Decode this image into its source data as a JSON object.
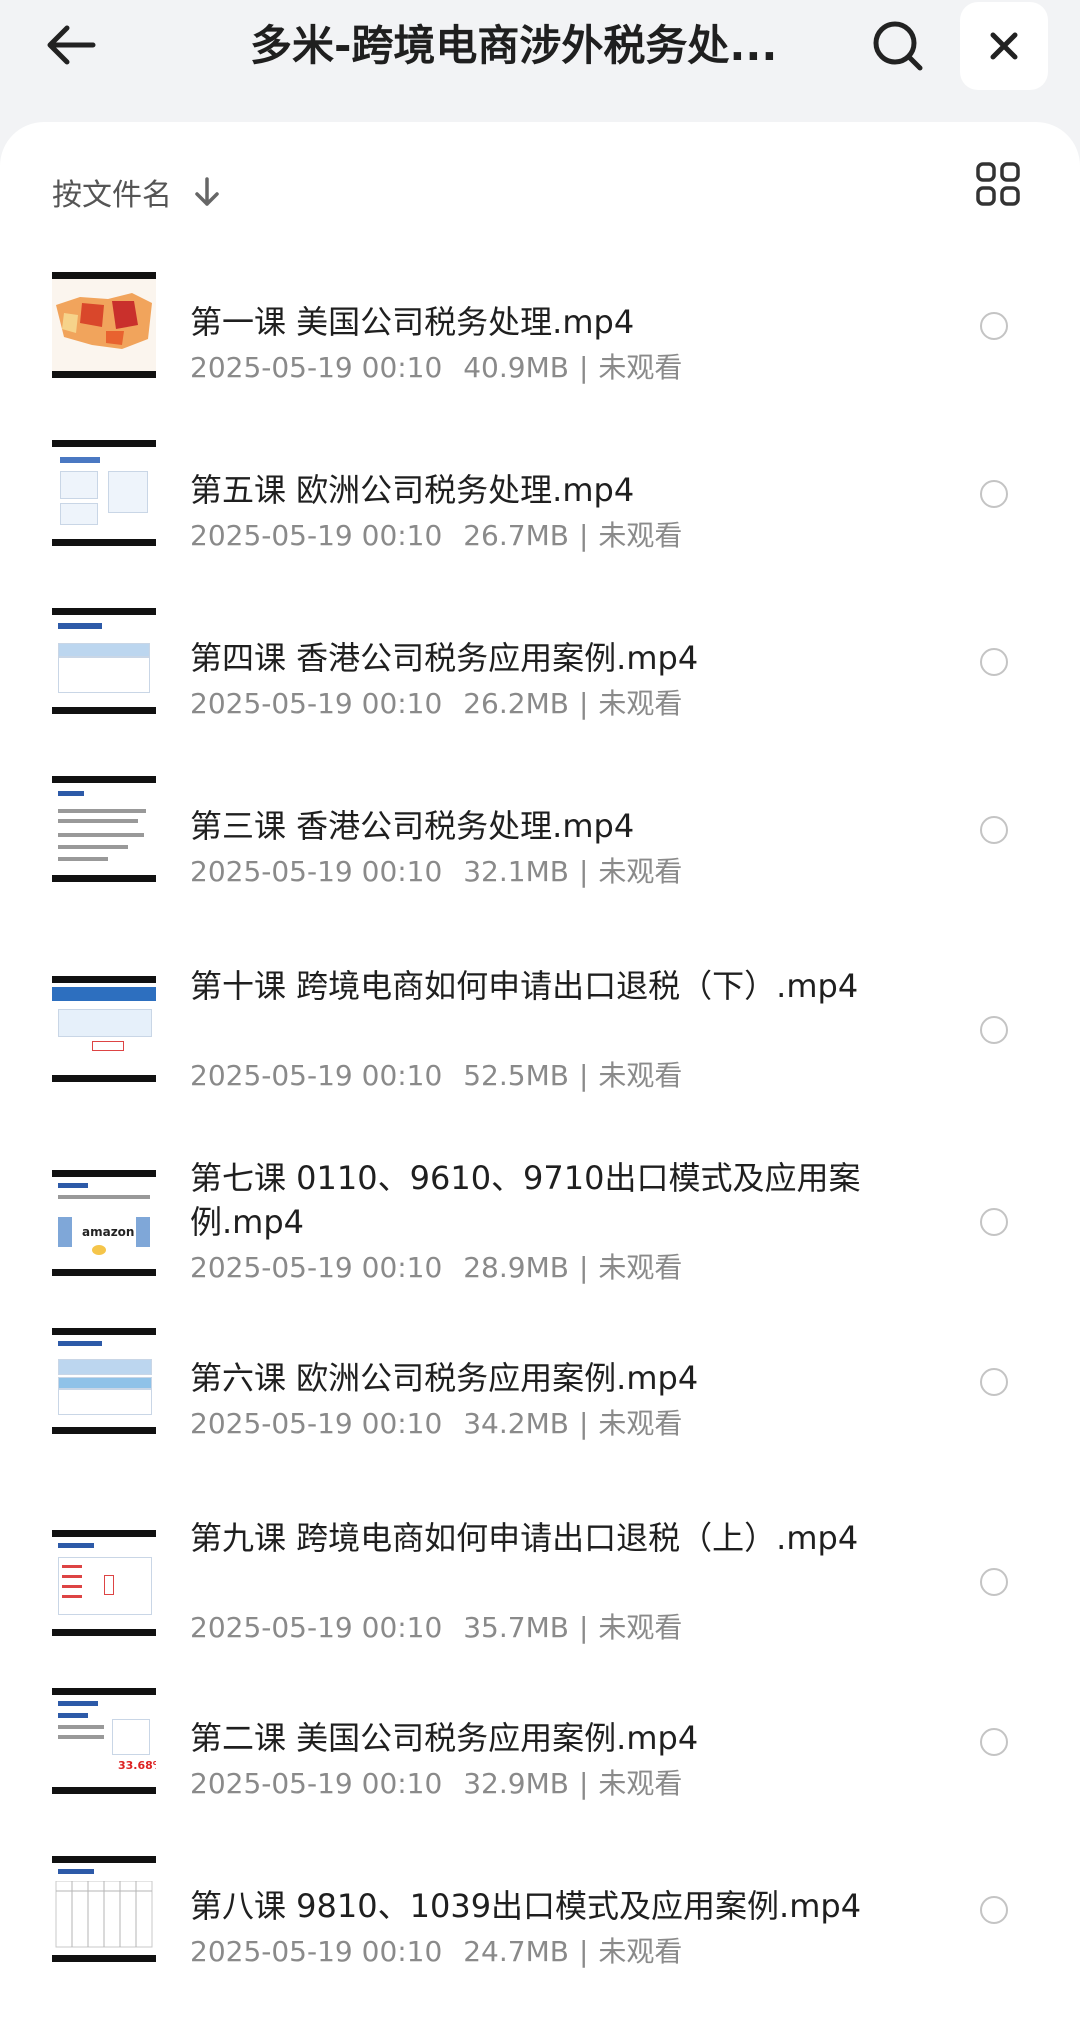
{
  "header": {
    "title": "多米-跨境电商涉外税务处..."
  },
  "toolbar": {
    "sort_label": "按文件名"
  },
  "files": [
    {
      "name": "第一课 美国公司税务处理.mp4",
      "date": "2025-05-19 00:10",
      "size": "40.9MB",
      "status": "未观看"
    },
    {
      "name": "第五课 欧洲公司税务处理.mp4",
      "date": "2025-05-19 00:10",
      "size": "26.7MB",
      "status": "未观看"
    },
    {
      "name": "第四课 香港公司税务应用案例.mp4",
      "date": "2025-05-19 00:10",
      "size": "26.2MB",
      "status": "未观看"
    },
    {
      "name": "第三课 香港公司税务处理.mp4",
      "date": "2025-05-19 00:10",
      "size": "32.1MB",
      "status": "未观看"
    },
    {
      "name": "第十课 跨境电商如何申请出口退税（下）.mp4",
      "date": "2025-05-19 00:10",
      "size": "52.5MB",
      "status": "未观看"
    },
    {
      "name": "第七课 0110、9610、9710出口模式及应用案例.mp4",
      "date": "2025-05-19 00:10",
      "size": "28.9MB",
      "status": "未观看"
    },
    {
      "name": "第六课 欧洲公司税务应用案例.mp4",
      "date": "2025-05-19 00:10",
      "size": "34.2MB",
      "status": "未观看"
    },
    {
      "name": "第九课 跨境电商如何申请出口退税（上）.mp4",
      "date": "2025-05-19 00:10",
      "size": "35.7MB",
      "status": "未观看"
    },
    {
      "name": "第二课 美国公司税务应用案例.mp4",
      "date": "2025-05-19 00:10",
      "size": "32.9MB",
      "status": "未观看"
    },
    {
      "name": "第八课 9810、1039出口模式及应用案例.mp4",
      "date": "2025-05-19 00:10",
      "size": "24.7MB",
      "status": "未观看"
    }
  ],
  "icons": {
    "back": "arrow-left-icon",
    "search": "search-icon",
    "close": "close-icon",
    "sort": "arrow-down-icon",
    "view": "grid-view-icon"
  }
}
